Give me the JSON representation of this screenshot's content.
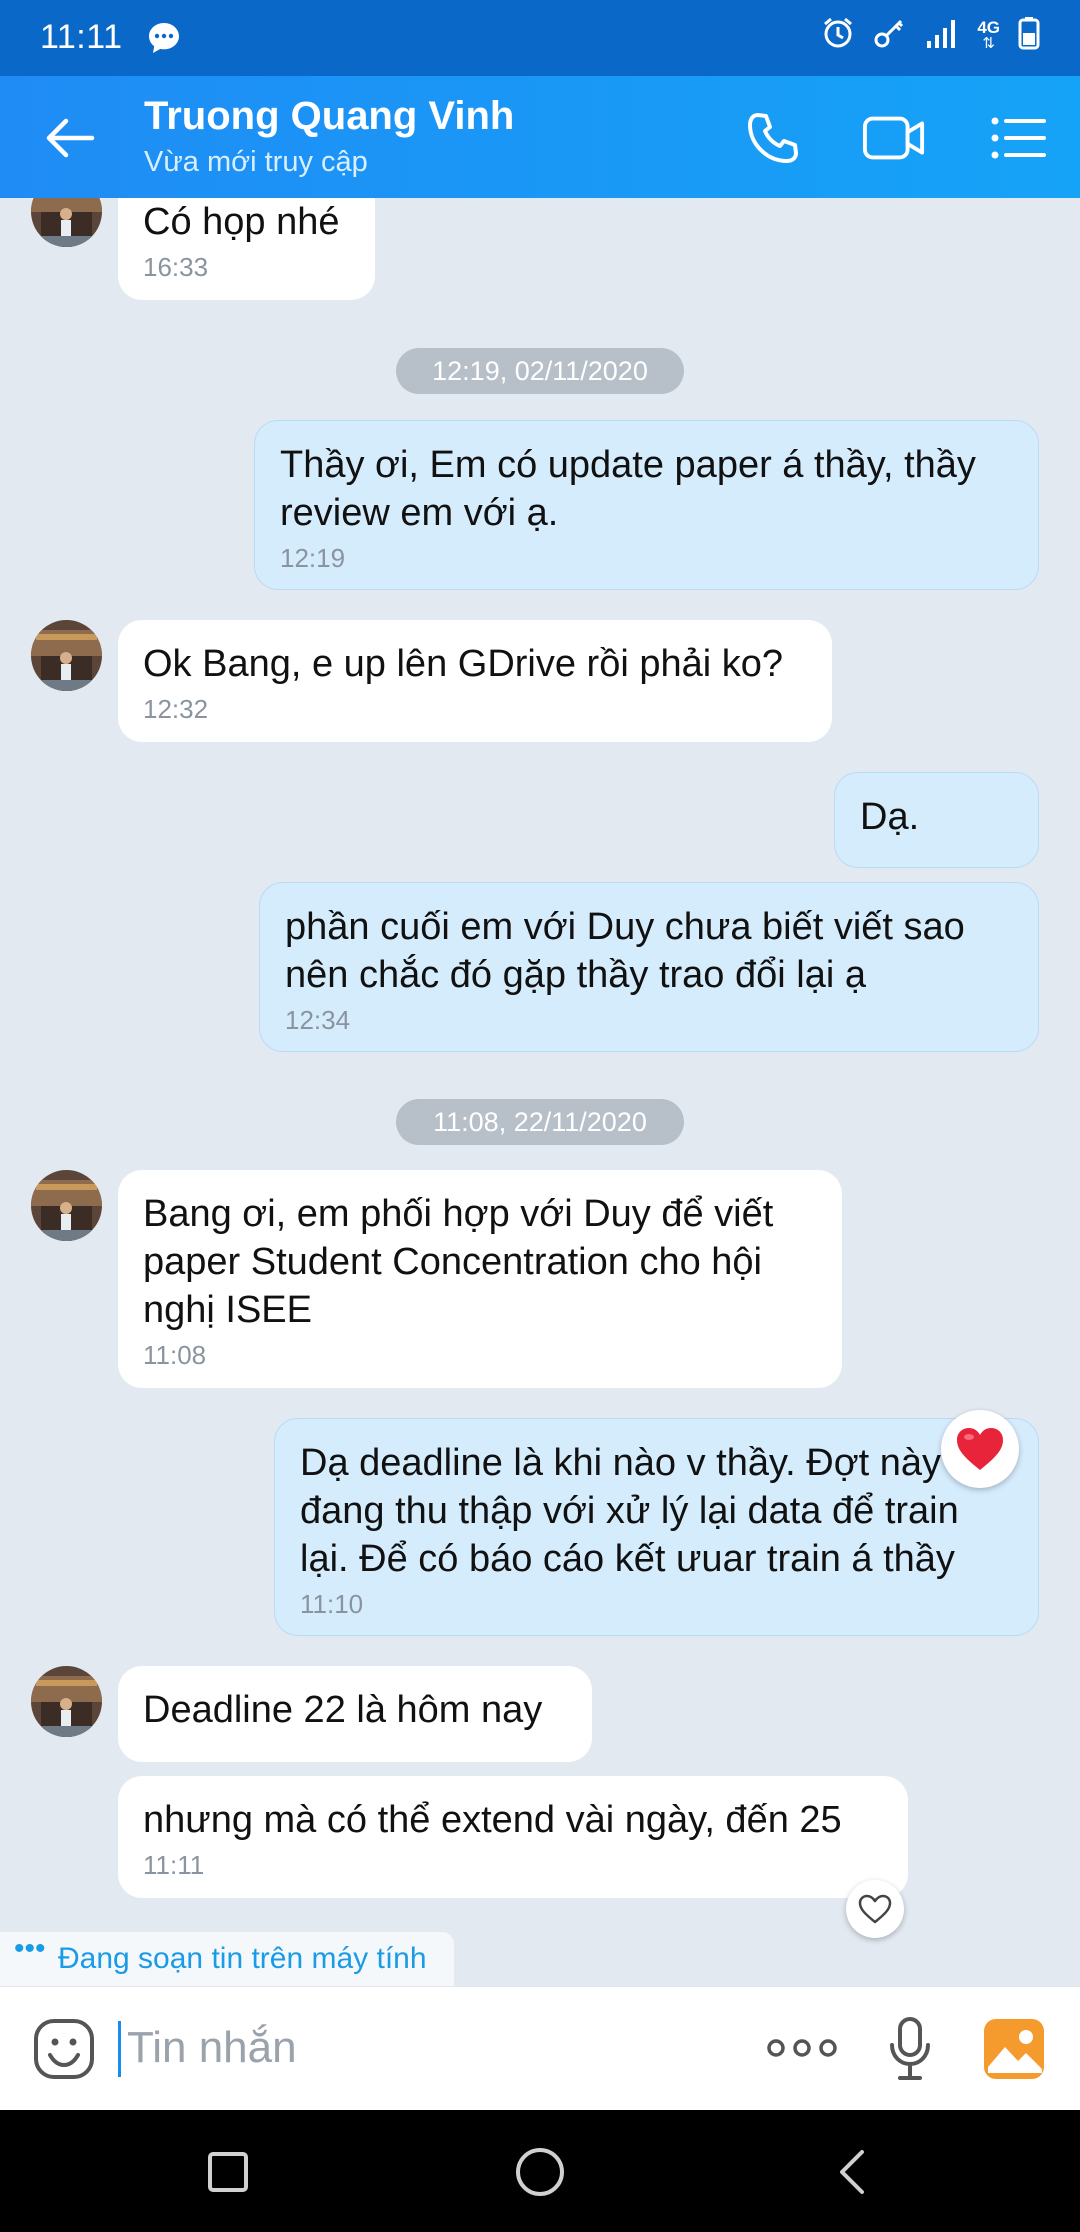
{
  "status_bar": {
    "time": "11:11",
    "network": "4G"
  },
  "header": {
    "contact_name": "Truong Quang Vinh",
    "contact_status": "Vừa mới truy cập"
  },
  "messages": [
    {
      "text": "Có họp nhé",
      "time": "16:33"
    },
    {
      "date": "12:19, 02/11/2020"
    },
    {
      "text": "Thầy ơi, Em có update paper á thầy, thầy review em với ạ.",
      "time": "12:19"
    },
    {
      "text": "Ok Bang, e up lên GDrive rồi phải ko?",
      "time": "12:32"
    },
    {
      "text": "Dạ."
    },
    {
      "text": "phần cuối em với Duy chưa biết viết sao nên chắc đó gặp thầy trao đổi lại ạ",
      "time": "12:34"
    },
    {
      "date": "11:08, 22/11/2020"
    },
    {
      "text": "Bang ơi, em phối hợp với Duy để viết paper Student Concentration cho hội nghị ISEE",
      "time": "11:08"
    },
    {
      "text": "Dạ deadline là khi nào v thầy. Đợt này e đang thu thập với xử lý lại data để train lại. Để có báo cáo kết ưuar train á thầy",
      "time": "11:10"
    },
    {
      "text": "Deadline 22 là hôm nay"
    },
    {
      "text": "nhưng mà có thể extend vài ngày, đến 25",
      "time": "11:11"
    }
  ],
  "typing_indicator": {
    "dots": "•••",
    "text": "Đang soạn tin trên máy tính"
  },
  "input": {
    "placeholder": "Tin nhắn"
  },
  "colors": {
    "header": "#1f8cf5",
    "status_bar": "#0a68c9",
    "outgoing_bubble": "#d5ecfd",
    "incoming_bubble": "#ffffff",
    "chat_background": "#e2e9f1",
    "heart": "#e8243b"
  }
}
